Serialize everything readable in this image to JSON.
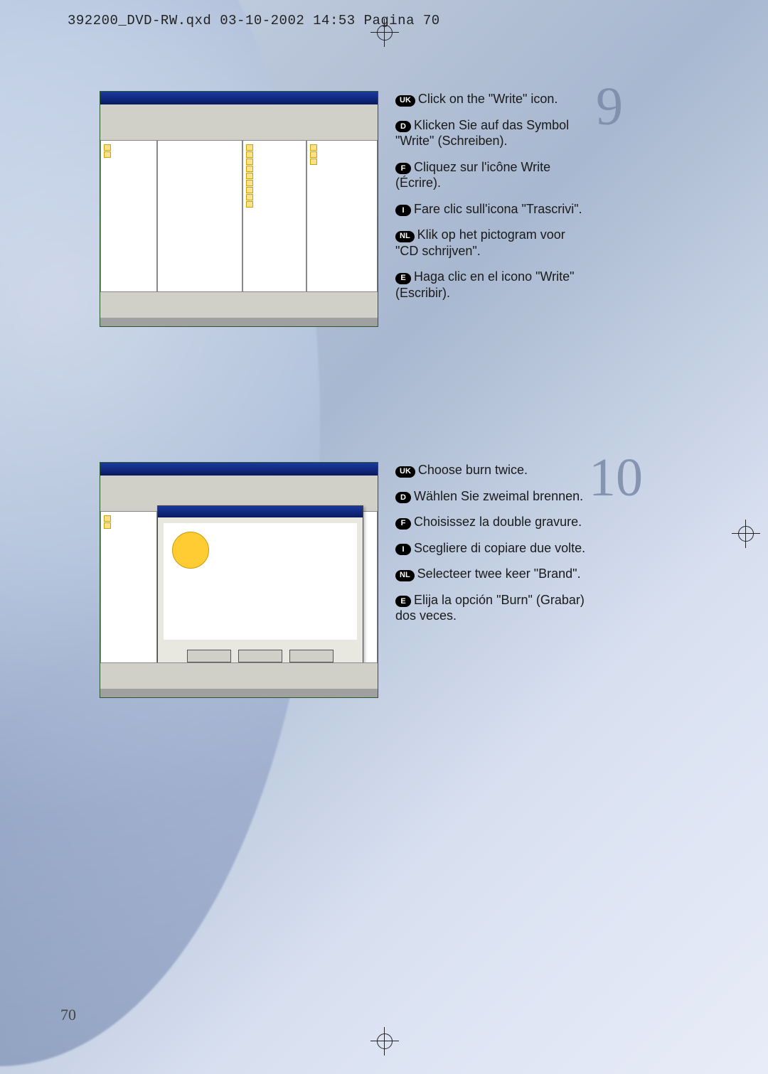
{
  "header": "392200_DVD-RW.qxd  03-10-2002  14:53  Pagina 70",
  "page_number": "70",
  "step9": {
    "number": "9",
    "items": [
      {
        "lang": "UK",
        "text": "Click on the \"Write\" icon."
      },
      {
        "lang": "D",
        "text": "Klicken Sie auf das Symbol \"Write\" (Schreiben)."
      },
      {
        "lang": "F",
        "text": "Cliquez sur l'icône Write (Écrire)."
      },
      {
        "lang": "I",
        "text": "Fare clic sull'icona \"Trascrivi\"."
      },
      {
        "lang": "NL",
        "text": "Klik op het pictogram voor \"CD schrijven\"."
      },
      {
        "lang": "E",
        "text": "Haga clic en el icono \"Write\" (Escribir)."
      }
    ]
  },
  "step10": {
    "number": "10",
    "items": [
      {
        "lang": "UK",
        "text": "Choose burn twice."
      },
      {
        "lang": "D",
        "text": "Wählen Sie zweimal brennen."
      },
      {
        "lang": "F",
        "text": "Choisissez la double gravure."
      },
      {
        "lang": "I",
        "text": "Scegliere di copiare due volte."
      },
      {
        "lang": "NL",
        "text": "Selecteer twee keer \"Brand\"."
      },
      {
        "lang": "E",
        "text": "Elija la opción \"Burn\" (Grabar) dos veces."
      }
    ]
  }
}
